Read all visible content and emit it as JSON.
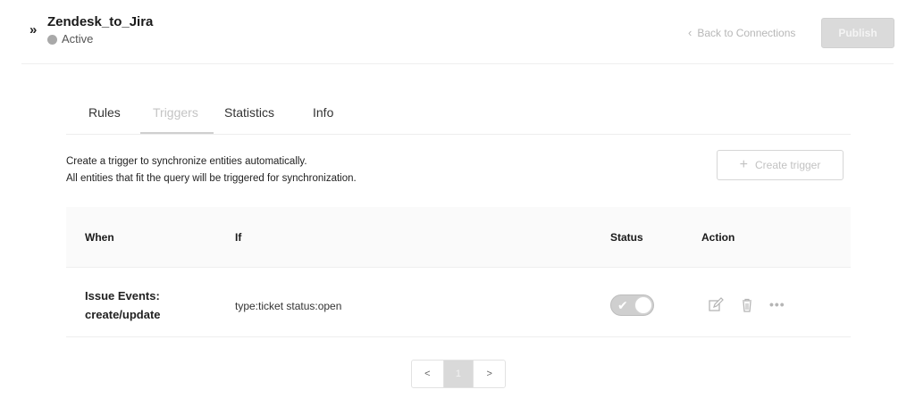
{
  "header": {
    "title": "Zendesk_to_Jira",
    "status": "Active",
    "back_label": "Back to Connections",
    "publish_label": "Publish"
  },
  "tabs": [
    {
      "label": "Rules",
      "active": false
    },
    {
      "label": "Triggers",
      "active": true
    },
    {
      "label": "Statistics",
      "active": false
    },
    {
      "label": "Info",
      "active": false
    }
  ],
  "description": {
    "line1": "Create a trigger to synchronize entities automatically.",
    "line2": "All entities that fit the query will be triggered for synchronization."
  },
  "create_trigger_label": "Create trigger",
  "table": {
    "columns": [
      "When",
      "If",
      "Status",
      "Action"
    ],
    "rows": [
      {
        "when_line1": "Issue Events:",
        "when_line2": "create/update",
        "if": "type:ticket status:open",
        "status_on": true
      }
    ]
  },
  "pagination": {
    "prev": "<",
    "current": "1",
    "next": ">"
  },
  "icons": {
    "expand": "double-chevron-right-icon",
    "back": "chevron-left-icon",
    "plus": "plus-icon",
    "edit": "edit-icon",
    "delete": "trash-icon",
    "more": "more-horizontal-icon",
    "check": "check-icon"
  },
  "colors": {
    "status_dot": "#a9a9a9",
    "muted": "#c2c2c2",
    "publish_bg": "#dadada"
  }
}
